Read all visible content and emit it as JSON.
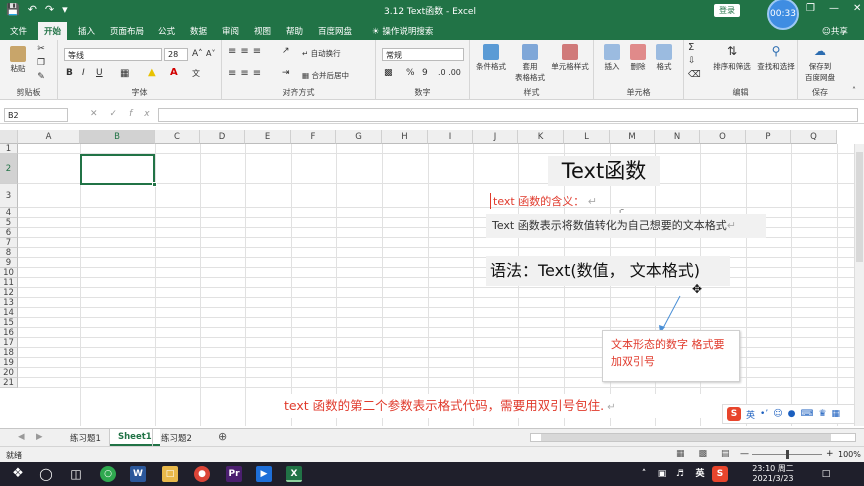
{
  "title": {
    "window_title": "3.12 Text函数 - Excel",
    "login_label": "登录",
    "timer": "00:33",
    "share_label": "共享"
  },
  "tabs": [
    "文件",
    "开始",
    "插入",
    "页面布局",
    "公式",
    "数据",
    "审阅",
    "视图",
    "帮助",
    "百度网盘",
    "操作说明搜索"
  ],
  "ribbon": {
    "clipboard": {
      "paste": "粘贴",
      "label": "剪贴板"
    },
    "font": {
      "family": "等线",
      "size": "28",
      "label": "字体",
      "bold": "B",
      "italic": "I",
      "underline": "U"
    },
    "alignment": {
      "wrap": "自动换行",
      "merge": "合并后居中",
      "label": "对齐方式"
    },
    "number": {
      "format": "常规",
      "label": "数字",
      "percent": "%",
      "comma": "9"
    },
    "styles": {
      "conditional": "条件格式",
      "table": "套用\n表格格式",
      "cell": "单元格样式",
      "label": "样式"
    },
    "cells": {
      "insert": "插入",
      "delete": "删除",
      "format": "格式",
      "label": "单元格"
    },
    "editing": {
      "sort": "排序和筛选",
      "find": "查找和选择",
      "label": "编辑"
    },
    "save": {
      "baidu": "保存到\n百度网盘",
      "label": "保存"
    }
  },
  "formula_bar": {
    "name_box": "B2",
    "formula": ""
  },
  "columns": [
    "A",
    "B",
    "C",
    "D",
    "E",
    "F",
    "G",
    "H",
    "I",
    "J",
    "K",
    "L",
    "M",
    "N",
    "O",
    "P",
    "Q"
  ],
  "rows": [
    "1",
    "2",
    "3",
    "4",
    "5",
    "6",
    "7",
    "8",
    "9",
    "10",
    "11",
    "12",
    "13",
    "14",
    "15",
    "16",
    "17",
    "18",
    "19",
    "20",
    "21"
  ],
  "content": {
    "heading": "Text函数",
    "meaning_label": "text 函数的含义：",
    "meaning_text": "Text 函数表示将数值转化为自己想要的文本格式",
    "syntax": "语法：Text(数值， 文本格式)",
    "note_box": "文本形态的数字 格式要加双引号",
    "bottom_note": "text 函数的第二个参数表示格式代码，需要用双引号包住."
  },
  "sheets": [
    "练习题1",
    "Sheet1",
    "练习题2"
  ],
  "active_sheet": "Sheet1",
  "status": {
    "mode": "就绪",
    "zoom": "100%"
  },
  "ime_label": "英",
  "taskbar": {
    "time": "23:10 周二",
    "date": "2021/3/23",
    "lang": "英"
  },
  "colors": {
    "excel_green": "#217346",
    "red_text": "#e03a2c",
    "arrow_blue": "#4a8fd6"
  }
}
